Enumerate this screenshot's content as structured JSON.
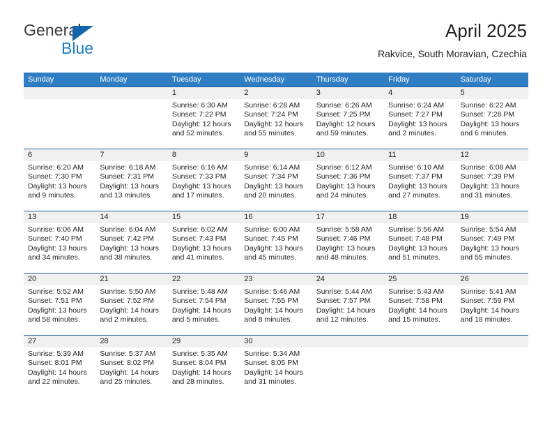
{
  "brand": {
    "name_dark": "General",
    "name_blue": "Blue",
    "triangle_icon": "triangle-logo-icon",
    "color_dark": "#3a3a3a",
    "color_blue": "#1a7bc4",
    "color_triangle": "#1565ad"
  },
  "header": {
    "title": "April 2025",
    "subtitle": "Rakvice, South Moravian, Czechia"
  },
  "colors": {
    "header_row_bg": "#2f7ec4",
    "header_row_text": "#ffffff",
    "row_divider": "#1f5fa0",
    "daynum_band_bg": "#f0f0f0",
    "text": "#231f20",
    "page_bg": "#ffffff"
  },
  "weekdays": [
    "Sunday",
    "Monday",
    "Tuesday",
    "Wednesday",
    "Thursday",
    "Friday",
    "Saturday"
  ],
  "weeks": [
    [
      {
        "day": "",
        "sunrise": "",
        "sunset": "",
        "daylight": "",
        "daylight2": ""
      },
      {
        "day": "",
        "sunrise": "",
        "sunset": "",
        "daylight": "",
        "daylight2": ""
      },
      {
        "day": "1",
        "sunrise": "Sunrise: 6:30 AM",
        "sunset": "Sunset: 7:22 PM",
        "daylight": "Daylight: 12 hours",
        "daylight2": "and 52 minutes."
      },
      {
        "day": "2",
        "sunrise": "Sunrise: 6:28 AM",
        "sunset": "Sunset: 7:24 PM",
        "daylight": "Daylight: 12 hours",
        "daylight2": "and 55 minutes."
      },
      {
        "day": "3",
        "sunrise": "Sunrise: 6:26 AM",
        "sunset": "Sunset: 7:25 PM",
        "daylight": "Daylight: 12 hours",
        "daylight2": "and 59 minutes."
      },
      {
        "day": "4",
        "sunrise": "Sunrise: 6:24 AM",
        "sunset": "Sunset: 7:27 PM",
        "daylight": "Daylight: 13 hours",
        "daylight2": "and 2 minutes."
      },
      {
        "day": "5",
        "sunrise": "Sunrise: 6:22 AM",
        "sunset": "Sunset: 7:28 PM",
        "daylight": "Daylight: 13 hours",
        "daylight2": "and 6 minutes."
      }
    ],
    [
      {
        "day": "6",
        "sunrise": "Sunrise: 6:20 AM",
        "sunset": "Sunset: 7:30 PM",
        "daylight": "Daylight: 13 hours",
        "daylight2": "and 9 minutes."
      },
      {
        "day": "7",
        "sunrise": "Sunrise: 6:18 AM",
        "sunset": "Sunset: 7:31 PM",
        "daylight": "Daylight: 13 hours",
        "daylight2": "and 13 minutes."
      },
      {
        "day": "8",
        "sunrise": "Sunrise: 6:16 AM",
        "sunset": "Sunset: 7:33 PM",
        "daylight": "Daylight: 13 hours",
        "daylight2": "and 17 minutes."
      },
      {
        "day": "9",
        "sunrise": "Sunrise: 6:14 AM",
        "sunset": "Sunset: 7:34 PM",
        "daylight": "Daylight: 13 hours",
        "daylight2": "and 20 minutes."
      },
      {
        "day": "10",
        "sunrise": "Sunrise: 6:12 AM",
        "sunset": "Sunset: 7:36 PM",
        "daylight": "Daylight: 13 hours",
        "daylight2": "and 24 minutes."
      },
      {
        "day": "11",
        "sunrise": "Sunrise: 6:10 AM",
        "sunset": "Sunset: 7:37 PM",
        "daylight": "Daylight: 13 hours",
        "daylight2": "and 27 minutes."
      },
      {
        "day": "12",
        "sunrise": "Sunrise: 6:08 AM",
        "sunset": "Sunset: 7:39 PM",
        "daylight": "Daylight: 13 hours",
        "daylight2": "and 31 minutes."
      }
    ],
    [
      {
        "day": "13",
        "sunrise": "Sunrise: 6:06 AM",
        "sunset": "Sunset: 7:40 PM",
        "daylight": "Daylight: 13 hours",
        "daylight2": "and 34 minutes."
      },
      {
        "day": "14",
        "sunrise": "Sunrise: 6:04 AM",
        "sunset": "Sunset: 7:42 PM",
        "daylight": "Daylight: 13 hours",
        "daylight2": "and 38 minutes."
      },
      {
        "day": "15",
        "sunrise": "Sunrise: 6:02 AM",
        "sunset": "Sunset: 7:43 PM",
        "daylight": "Daylight: 13 hours",
        "daylight2": "and 41 minutes."
      },
      {
        "day": "16",
        "sunrise": "Sunrise: 6:00 AM",
        "sunset": "Sunset: 7:45 PM",
        "daylight": "Daylight: 13 hours",
        "daylight2": "and 45 minutes."
      },
      {
        "day": "17",
        "sunrise": "Sunrise: 5:58 AM",
        "sunset": "Sunset: 7:46 PM",
        "daylight": "Daylight: 13 hours",
        "daylight2": "and 48 minutes."
      },
      {
        "day": "18",
        "sunrise": "Sunrise: 5:56 AM",
        "sunset": "Sunset: 7:48 PM",
        "daylight": "Daylight: 13 hours",
        "daylight2": "and 51 minutes."
      },
      {
        "day": "19",
        "sunrise": "Sunrise: 5:54 AM",
        "sunset": "Sunset: 7:49 PM",
        "daylight": "Daylight: 13 hours",
        "daylight2": "and 55 minutes."
      }
    ],
    [
      {
        "day": "20",
        "sunrise": "Sunrise: 5:52 AM",
        "sunset": "Sunset: 7:51 PM",
        "daylight": "Daylight: 13 hours",
        "daylight2": "and 58 minutes."
      },
      {
        "day": "21",
        "sunrise": "Sunrise: 5:50 AM",
        "sunset": "Sunset: 7:52 PM",
        "daylight": "Daylight: 14 hours",
        "daylight2": "and 2 minutes."
      },
      {
        "day": "22",
        "sunrise": "Sunrise: 5:48 AM",
        "sunset": "Sunset: 7:54 PM",
        "daylight": "Daylight: 14 hours",
        "daylight2": "and 5 minutes."
      },
      {
        "day": "23",
        "sunrise": "Sunrise: 5:46 AM",
        "sunset": "Sunset: 7:55 PM",
        "daylight": "Daylight: 14 hours",
        "daylight2": "and 8 minutes."
      },
      {
        "day": "24",
        "sunrise": "Sunrise: 5:44 AM",
        "sunset": "Sunset: 7:57 PM",
        "daylight": "Daylight: 14 hours",
        "daylight2": "and 12 minutes."
      },
      {
        "day": "25",
        "sunrise": "Sunrise: 5:43 AM",
        "sunset": "Sunset: 7:58 PM",
        "daylight": "Daylight: 14 hours",
        "daylight2": "and 15 minutes."
      },
      {
        "day": "26",
        "sunrise": "Sunrise: 5:41 AM",
        "sunset": "Sunset: 7:59 PM",
        "daylight": "Daylight: 14 hours",
        "daylight2": "and 18 minutes."
      }
    ],
    [
      {
        "day": "27",
        "sunrise": "Sunrise: 5:39 AM",
        "sunset": "Sunset: 8:01 PM",
        "daylight": "Daylight: 14 hours",
        "daylight2": "and 22 minutes."
      },
      {
        "day": "28",
        "sunrise": "Sunrise: 5:37 AM",
        "sunset": "Sunset: 8:02 PM",
        "daylight": "Daylight: 14 hours",
        "daylight2": "and 25 minutes."
      },
      {
        "day": "29",
        "sunrise": "Sunrise: 5:35 AM",
        "sunset": "Sunset: 8:04 PM",
        "daylight": "Daylight: 14 hours",
        "daylight2": "and 28 minutes."
      },
      {
        "day": "30",
        "sunrise": "Sunrise: 5:34 AM",
        "sunset": "Sunset: 8:05 PM",
        "daylight": "Daylight: 14 hours",
        "daylight2": "and 31 minutes."
      },
      {
        "day": "",
        "sunrise": "",
        "sunset": "",
        "daylight": "",
        "daylight2": ""
      },
      {
        "day": "",
        "sunrise": "",
        "sunset": "",
        "daylight": "",
        "daylight2": ""
      },
      {
        "day": "",
        "sunrise": "",
        "sunset": "",
        "daylight": "",
        "daylight2": ""
      }
    ]
  ]
}
